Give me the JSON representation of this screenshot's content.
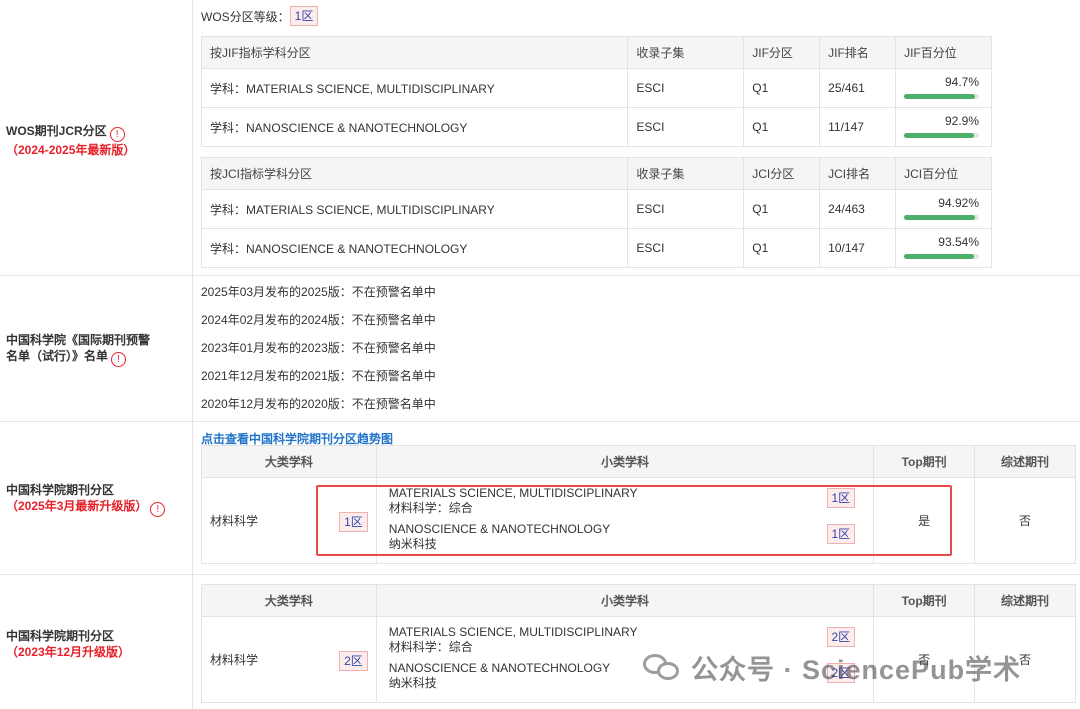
{
  "wos": {
    "label": "WOS期刊JCR分区",
    "label_sub": "（2024-2025年最新版）",
    "level_label": "WOS分区等级：",
    "level_value": "1区",
    "jif_headers": [
      "按JIF指标学科分区",
      "收录子集",
      "JIF分区",
      "JIF排名",
      "JIF百分位"
    ],
    "jif_rows": [
      {
        "subject": "学科：MATERIALS SCIENCE, MULTIDISCIPLINARY",
        "subset": "ESCI",
        "quartile": "Q1",
        "rank": "25/461",
        "percentile": "94.7%",
        "fill": 94.7
      },
      {
        "subject": "学科：NANOSCIENCE & NANOTECHNOLOGY",
        "subset": "ESCI",
        "quartile": "Q1",
        "rank": "11/147",
        "percentile": "92.9%",
        "fill": 92.9
      }
    ],
    "jci_headers": [
      "按JCI指标学科分区",
      "收录子集",
      "JCI分区",
      "JCI排名",
      "JCI百分位"
    ],
    "jci_rows": [
      {
        "subject": "学科：MATERIALS SCIENCE, MULTIDISCIPLINARY",
        "subset": "ESCI",
        "quartile": "Q1",
        "rank": "24/463",
        "percentile": "94.92%",
        "fill": 94.92
      },
      {
        "subject": "学科：NANOSCIENCE & NANOTECHNOLOGY",
        "subset": "ESCI",
        "quartile": "Q1",
        "rank": "10/147",
        "percentile": "93.54%",
        "fill": 93.54
      }
    ]
  },
  "warning": {
    "label_line1": "中国科学院《国际期刊预警",
    "label_line2": "名单（试行）》名单",
    "items": [
      "2025年03月发布的2025版：不在预警名单中",
      "2024年02月发布的2024版：不在预警名单中",
      "2023年01月发布的2023版：不在预警名单中",
      "2021年12月发布的2021版：不在预警名单中",
      "2020年12月发布的2020版：不在预警名单中"
    ]
  },
  "cas2025": {
    "label": "中国科学院期刊分区",
    "label_sub": "（2025年3月最新升级版）",
    "trend_link": "点击查看中国科学院期刊分区趋势图",
    "headers": [
      "大类学科",
      "小类学科",
      "Top期刊",
      "综述期刊"
    ],
    "big_category": "材料科学",
    "big_tier": "1区",
    "subs": [
      {
        "en": "MATERIALS SCIENCE, MULTIDISCIPLINARY",
        "cn": "材料科学：综合",
        "tier": "1区"
      },
      {
        "en": "NANOSCIENCE & NANOTECHNOLOGY",
        "cn": "纳米科技",
        "tier": "1区"
      }
    ],
    "top": "是",
    "review": "否"
  },
  "cas2023": {
    "label": "中国科学院期刊分区",
    "label_sub": "（2023年12月升级版）",
    "headers": [
      "大类学科",
      "小类学科",
      "Top期刊",
      "综述期刊"
    ],
    "big_category": "材料科学",
    "big_tier": "2区",
    "subs": [
      {
        "en": "MATERIALS SCIENCE, MULTIDISCIPLINARY",
        "cn": "材料科学：综合",
        "tier": "2区"
      },
      {
        "en": "NANOSCIENCE & NANOTECHNOLOGY",
        "cn": "纳米科技",
        "tier": "2区"
      }
    ],
    "top": "否",
    "review": "否"
  },
  "info_icon": "!",
  "watermark": "公众号 · SciencePub学术"
}
